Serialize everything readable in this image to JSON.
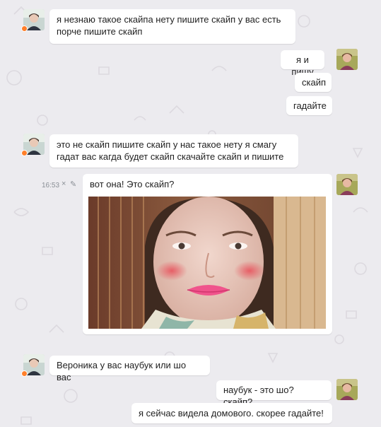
{
  "messages": [
    {
      "text": "я незнаю такое скайпа нету пишите скайп у вас есть порче пишите скайп"
    },
    {
      "text": "я и пишу"
    },
    {
      "text": "скайп"
    },
    {
      "text": "гадайте"
    },
    {
      "text": "это не скайп пишите скайп у нас такое нету я смагу гадат вас кагда будет скайп скачайте скайп и пишите"
    },
    {
      "text": "вот она! Это скайп?",
      "time": "16:53",
      "has_photo": true
    },
    {
      "text": "Вероника у вас наубук или шо вас"
    },
    {
      "text": "наубук - это шо? скайп?"
    },
    {
      "text": "я сейчас видела домового. скорее гадайте!"
    }
  ],
  "icons": {
    "close": "×",
    "edit": "✎"
  },
  "colors": {
    "background": "#ecebef",
    "bubble": "#ffffff",
    "online_dot": "#ff7f2a",
    "timestamp": "#8a8f96"
  }
}
